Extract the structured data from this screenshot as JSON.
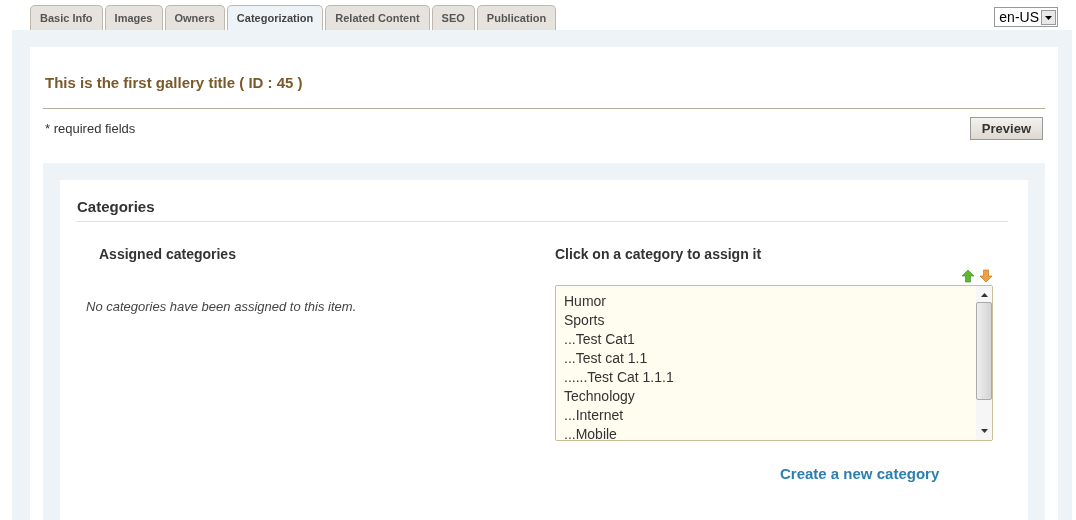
{
  "tabs": [
    {
      "label": "Basic Info",
      "selected": false
    },
    {
      "label": "Images",
      "selected": false
    },
    {
      "label": "Owners",
      "selected": false
    },
    {
      "label": "Categorization",
      "selected": true
    },
    {
      "label": "Related Content",
      "selected": false
    },
    {
      "label": "SEO",
      "selected": false
    },
    {
      "label": "Publication",
      "selected": false
    }
  ],
  "language_select": {
    "value": "en-US"
  },
  "title": "This is the first gallery title ( ID : 45 )",
  "required_note": "* required fields",
  "preview_button": "Preview",
  "categories": {
    "heading": "Categories",
    "assigned": {
      "heading": "Assigned categories",
      "empty_message": "No categories have been assigned to this item."
    },
    "available": {
      "heading": "Click on a category to assign it",
      "items": [
        "Humor",
        "Sports",
        "...Test Cat1",
        "...Test cat 1.1",
        "......Test Cat 1.1.1",
        "Technology",
        "...Internet",
        "...Mobile"
      ]
    },
    "create_link": "Create a new category"
  }
}
